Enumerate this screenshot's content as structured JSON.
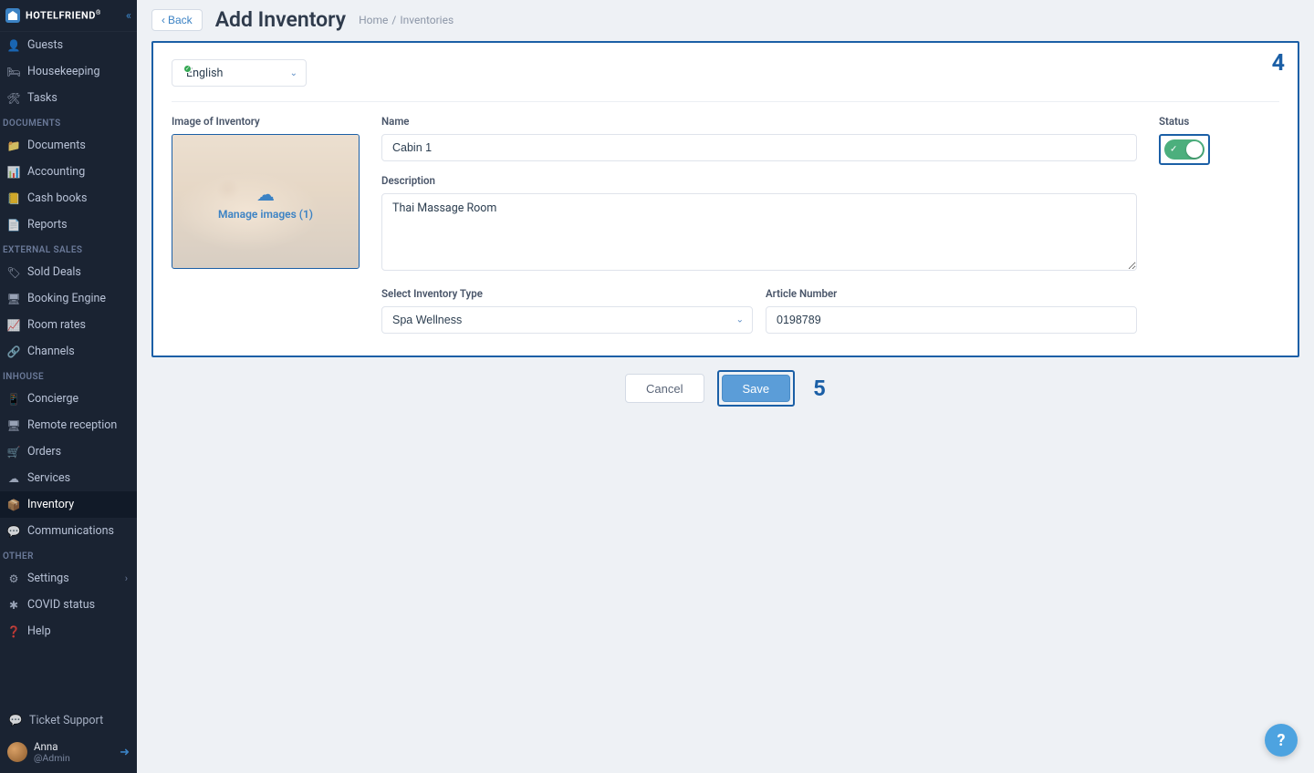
{
  "brand": "HOTELFRIEND",
  "sidebar": {
    "items": [
      {
        "label": "Guests",
        "icon": "👤"
      },
      {
        "label": "Housekeeping",
        "icon": "🛏"
      },
      {
        "label": "Tasks",
        "icon": "🛠"
      }
    ],
    "sections": [
      {
        "label": "DOCUMENTS",
        "items": [
          {
            "label": "Documents",
            "icon": "📁"
          },
          {
            "label": "Accounting",
            "icon": "📊"
          },
          {
            "label": "Cash books",
            "icon": "📒"
          },
          {
            "label": "Reports",
            "icon": "📄"
          }
        ]
      },
      {
        "label": "EXTERNAL SALES",
        "items": [
          {
            "label": "Sold Deals",
            "icon": "🏷"
          },
          {
            "label": "Booking Engine",
            "icon": "🖥"
          },
          {
            "label": "Room rates",
            "icon": "📈"
          },
          {
            "label": "Channels",
            "icon": "🔗"
          }
        ]
      },
      {
        "label": "INHOUSE",
        "items": [
          {
            "label": "Concierge",
            "icon": "📱"
          },
          {
            "label": "Remote reception",
            "icon": "🖥"
          },
          {
            "label": "Orders",
            "icon": "🛒"
          },
          {
            "label": "Services",
            "icon": "☁"
          },
          {
            "label": "Inventory",
            "icon": "📦",
            "active": true
          },
          {
            "label": "Communications",
            "icon": "💬"
          }
        ]
      },
      {
        "label": "OTHER",
        "items": [
          {
            "label": "Settings",
            "icon": "⚙",
            "chevron": true
          },
          {
            "label": "COVID status",
            "icon": "✱"
          },
          {
            "label": "Help",
            "icon": "❓"
          }
        ]
      }
    ],
    "ticket": "Ticket Support",
    "user": {
      "name": "Anna",
      "role": "@Admin"
    }
  },
  "header": {
    "back": "Back",
    "title": "Add Inventory",
    "crumbs": [
      "Home",
      "Inventories"
    ]
  },
  "form": {
    "language": "English",
    "labels": {
      "image": "Image of Inventory",
      "name": "Name",
      "status": "Status",
      "description": "Description",
      "type": "Select Inventory Type",
      "article": "Article Number"
    },
    "values": {
      "name": "Cabin 1",
      "description": "Thai Massage Room",
      "type": "Spa Wellness",
      "article": "0198789",
      "status_on": true
    },
    "image_manage": "Manage images (1)"
  },
  "actions": {
    "cancel": "Cancel",
    "save": "Save"
  },
  "annotations": {
    "a4": "4",
    "a5": "5"
  }
}
